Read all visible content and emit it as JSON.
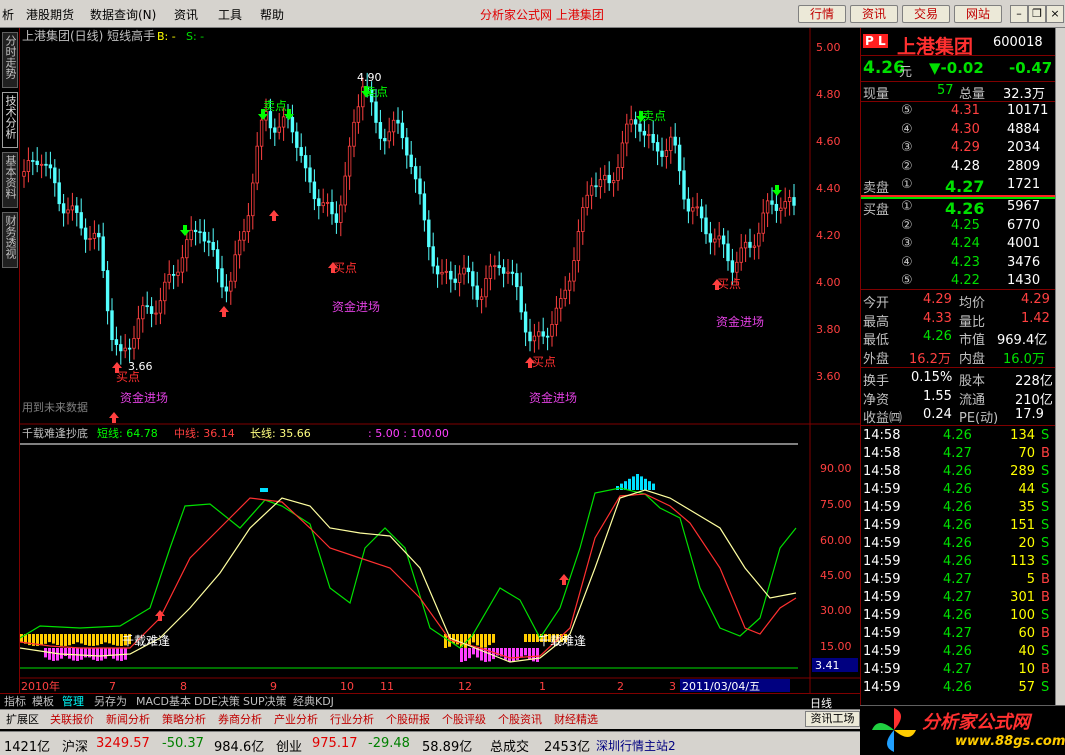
{
  "menu": {
    "items": [
      "析",
      "港股期货",
      "数据查询(N)",
      "资讯",
      "工具",
      "帮助"
    ],
    "center_title": "分析家公式网 上港集团",
    "right_buttons": [
      "行情",
      "资讯",
      "交易",
      "网站"
    ]
  },
  "left_tabs": [
    "分时走势",
    "技术分析",
    "基本资料",
    "财务透视"
  ],
  "chart": {
    "header": "上港集团(日线) 短线高手",
    "header_b": "B: -",
    "header_s": "S: -",
    "annotations": {
      "sell": "卖点",
      "buy": "买点",
      "fund": "资金进场",
      "future": "用到未来数据",
      "high": "4.90",
      "low": "3.66",
      "bottom": "千载难逢"
    },
    "price_axis": [
      "5.00",
      "4.80",
      "4.60",
      "4.40",
      "4.20",
      "4.00",
      "3.80",
      "3.60"
    ],
    "indicator": {
      "name": "千载难逢抄底",
      "short_label": "短线: 64.78",
      "mid_label": "中线: 36.14",
      "long_label": "长线: 35.66",
      "params": ": 5.00 : 100.00",
      "axis": [
        "90.00",
        "75.00",
        "60.00",
        "45.00",
        "30.00",
        "15.00"
      ],
      "last_value": "3.41"
    },
    "date_axis": [
      "2010年",
      "7",
      "8",
      "9",
      "10",
      "11",
      "12",
      "1",
      "2",
      "3"
    ],
    "current_date": "2011/03/04/五"
  },
  "chart_data": {
    "type": "line",
    "title": "上港集团(日线) 短线高手",
    "x": [
      "2010年",
      "7",
      "8",
      "9",
      "10",
      "11",
      "12",
      "1",
      "2",
      "3"
    ],
    "ylim": [
      3.6,
      5.0
    ],
    "series": [
      {
        "name": "短线",
        "values": [
          64.78
        ]
      },
      {
        "name": "中线",
        "values": [
          36.14
        ]
      },
      {
        "name": "长线",
        "values": [
          35.66
        ]
      }
    ]
  },
  "bottom_tabs": [
    "指标",
    "模板",
    "管理",
    "另存为",
    "MACD基本",
    "DDE决策",
    "SUP决策",
    "经典KDJ"
  ],
  "period": "日线",
  "func_buttons": [
    "扩展区",
    "关联报价",
    "新闻分析",
    "策略分析",
    "券商分析",
    "产业分析",
    "行业分析",
    "个股研报",
    "个股评级",
    "个股资讯",
    "财经精选"
  ],
  "info_button": "资讯工场",
  "status": {
    "a": "1421亿",
    "hs_label": "沪深",
    "hs_index": "3249.57",
    "hs_change": "-50.37",
    "hs_amount": "984.6亿",
    "cy_label": "创业",
    "cy_index": "975.17",
    "cy_change": "-29.48",
    "cy_amount": "58.89亿",
    "total_label": "总成交",
    "total_amount": "2453亿",
    "station": "深圳行情主站2"
  },
  "quote": {
    "badge": "P L",
    "name": "上港集团",
    "code": "600018",
    "price": "4.26",
    "unit": "元",
    "change": "▼-0.02",
    "change2": "-0.47",
    "cur_vol_label": "现量",
    "cur_vol": "57",
    "total_vol_label": "总量",
    "total_vol": "32.3万",
    "asks": [
      {
        "level": "⑤",
        "price": "4.31",
        "vol": "10171"
      },
      {
        "level": "④",
        "price": "4.30",
        "vol": "4884"
      },
      {
        "level": "③",
        "price": "4.29",
        "vol": "2034"
      },
      {
        "level": "②",
        "price": "4.28",
        "vol": "2809"
      },
      {
        "level": "①",
        "price": "4.27",
        "vol": "1721"
      }
    ],
    "ask_label": "卖盘",
    "bid_label": "买盘",
    "bids": [
      {
        "level": "①",
        "price": "4.26",
        "vol": "5967"
      },
      {
        "level": "②",
        "price": "4.25",
        "vol": "6770"
      },
      {
        "level": "③",
        "price": "4.24",
        "vol": "4001"
      },
      {
        "level": "④",
        "price": "4.23",
        "vol": "3476"
      },
      {
        "level": "⑤",
        "price": "4.22",
        "vol": "1430"
      }
    ],
    "stats": [
      {
        "l1": "今开",
        "v1": "4.29",
        "l2": "均价",
        "v2": "4.29"
      },
      {
        "l1": "最高",
        "v1": "4.33",
        "l2": "量比",
        "v2": "1.42"
      },
      {
        "l1": "最低",
        "v1": "4.26",
        "l2": "市值",
        "v2": "969.4亿"
      },
      {
        "l1": "外盘",
        "v1": "16.2万",
        "l2": "内盘",
        "v2": "16.0万"
      }
    ],
    "fundamentals": [
      {
        "l1": "换手",
        "v1": "0.15%",
        "l2": "股本",
        "v2": "228亿"
      },
      {
        "l1": "净资",
        "v1": "1.55",
        "l2": "流通",
        "v2": "210亿"
      },
      {
        "l1": "收益㈣",
        "v1": "0.24",
        "l2": "PE(动)",
        "v2": "17.9"
      }
    ],
    "ticks": [
      {
        "time": "14:58",
        "price": "4.26",
        "vol": "134",
        "side": "S"
      },
      {
        "time": "14:58",
        "price": "4.27",
        "vol": "70",
        "side": "B"
      },
      {
        "time": "14:58",
        "price": "4.26",
        "vol": "289",
        "side": "S"
      },
      {
        "time": "14:59",
        "price": "4.26",
        "vol": "44",
        "side": "S"
      },
      {
        "time": "14:59",
        "price": "4.26",
        "vol": "35",
        "side": "S"
      },
      {
        "time": "14:59",
        "price": "4.26",
        "vol": "151",
        "side": "S"
      },
      {
        "time": "14:59",
        "price": "4.26",
        "vol": "20",
        "side": "S"
      },
      {
        "time": "14:59",
        "price": "4.26",
        "vol": "113",
        "side": "S"
      },
      {
        "time": "14:59",
        "price": "4.27",
        "vol": "5",
        "side": "B"
      },
      {
        "time": "14:59",
        "price": "4.27",
        "vol": "301",
        "side": "B"
      },
      {
        "time": "14:59",
        "price": "4.26",
        "vol": "100",
        "side": "S"
      },
      {
        "time": "14:59",
        "price": "4.27",
        "vol": "60",
        "side": "B"
      },
      {
        "time": "14:59",
        "price": "4.26",
        "vol": "40",
        "side": "S"
      },
      {
        "time": "14:59",
        "price": "4.27",
        "vol": "10",
        "side": "B"
      },
      {
        "time": "14:59",
        "price": "4.26",
        "vol": "57",
        "side": "S"
      }
    ]
  },
  "logo": {
    "main": "分析家公式网",
    "url": "www.88gs.com"
  },
  "colors": {
    "up": "#ff4040",
    "down": "#00e000",
    "candle_down": "#54ffff",
    "frame": "#800000"
  }
}
